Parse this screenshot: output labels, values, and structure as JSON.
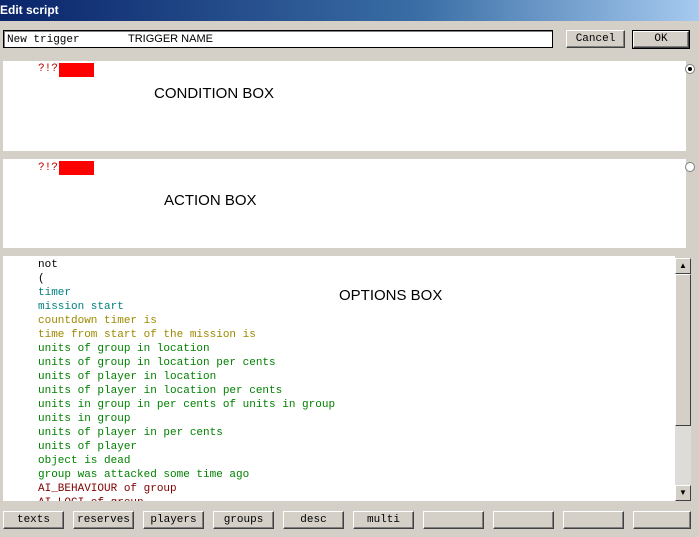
{
  "window": {
    "title": "Edit script"
  },
  "name_field": {
    "value": "New trigger",
    "annotation": "TRIGGER NAME"
  },
  "buttons": {
    "cancel": "Cancel",
    "ok": "OK"
  },
  "condition_box": {
    "token": "?!?",
    "annotation": "CONDITION BOX",
    "selected": true
  },
  "action_box": {
    "token": "?!?",
    "annotation": "ACTION BOX",
    "selected": false
  },
  "options_box": {
    "annotation": "OPTIONS BOX",
    "items": [
      {
        "text": "not",
        "color": "#000000"
      },
      {
        "text": "(",
        "color": "#000000"
      },
      {
        "text": "timer",
        "color": "#008080"
      },
      {
        "text": "mission start",
        "color": "#008080"
      },
      {
        "text": "countdown timer is",
        "color": "#9c8a00"
      },
      {
        "text": "time from start of the mission is",
        "color": "#9c8a00"
      },
      {
        "text": "units of group in location",
        "color": "#008000"
      },
      {
        "text": "units of group in location per cents",
        "color": "#008000"
      },
      {
        "text": "units of player in location",
        "color": "#008000"
      },
      {
        "text": "units of player in location per cents",
        "color": "#008000"
      },
      {
        "text": "units in group in per cents of units in group",
        "color": "#008000"
      },
      {
        "text": "units in group",
        "color": "#008000"
      },
      {
        "text": "units of player in per cents",
        "color": "#008000"
      },
      {
        "text": "units of player",
        "color": "#008000"
      },
      {
        "text": "object is dead",
        "color": "#008000"
      },
      {
        "text": "group was attacked some time ago",
        "color": "#008000"
      },
      {
        "text": "AI_BEHAVIOUR of group",
        "color": "#800000"
      },
      {
        "text": "AI_LOGI of group",
        "color": "#800000"
      }
    ]
  },
  "bottom_buttons": [
    "texts",
    "reserves",
    "players",
    "groups",
    "desc",
    "multi",
    "",
    "",
    "",
    ""
  ]
}
